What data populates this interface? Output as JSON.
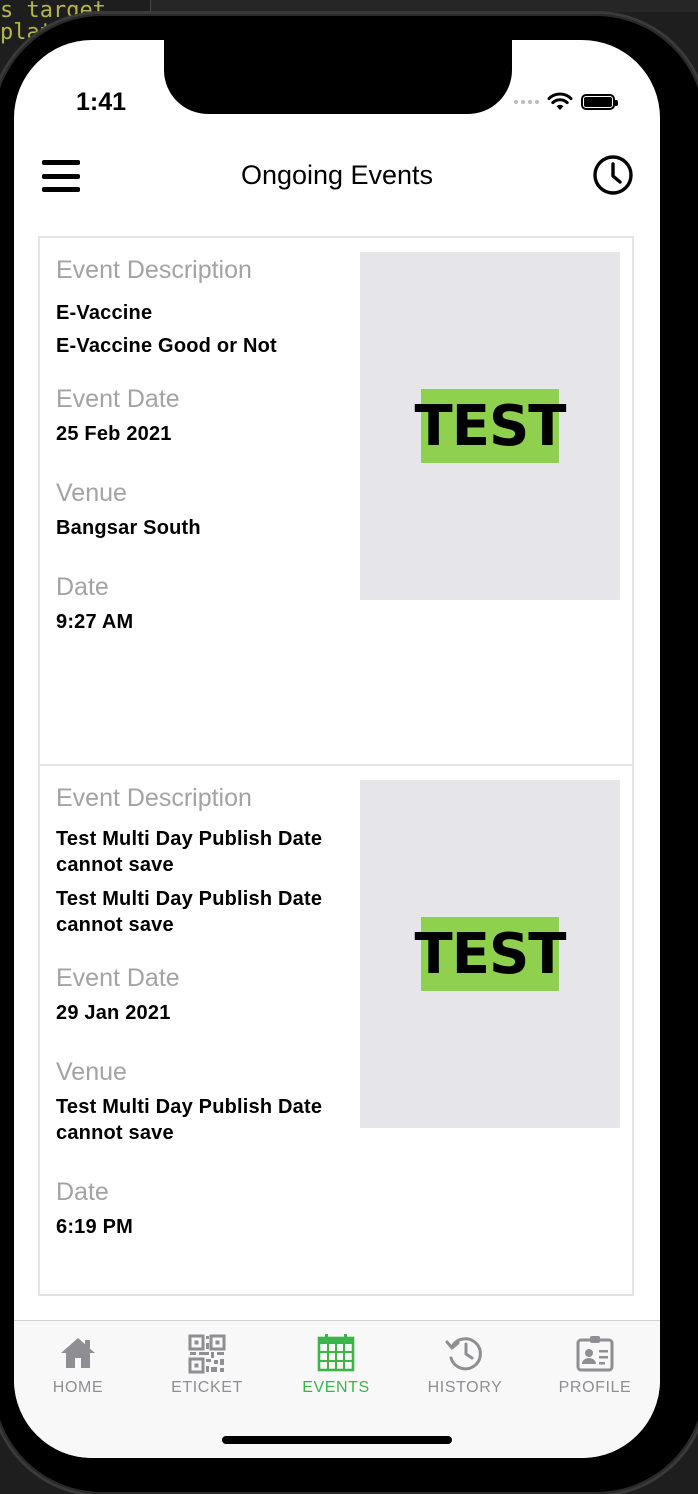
{
  "background_code": [
    "s target",
    "platf"
  ],
  "status_bar": {
    "time": "1:41"
  },
  "nav": {
    "title": "Ongoing Events"
  },
  "labels": {
    "description": "Event Description",
    "event_date": "Event Date",
    "venue": "Venue",
    "date": "Date"
  },
  "events": [
    {
      "name": "E-Vaccine",
      "description": "E-Vaccine Good or Not",
      "event_date": "25 Feb 2021",
      "venue": "Bangsar South",
      "time": "9:27 AM",
      "image_text": "TEST"
    },
    {
      "name": "Test Multi Day Publish Date cannot save",
      "description": "Test Multi Day Publish Date cannot save",
      "event_date": "29 Jan 2021",
      "venue": "Test Multi Day Publish Date cannot save",
      "time": "6:19 PM",
      "image_text": "TEST"
    }
  ],
  "tabs": [
    {
      "label": "HOME",
      "icon": "home-icon",
      "active": false
    },
    {
      "label": "ETICKET",
      "icon": "qr-code-icon",
      "active": false
    },
    {
      "label": "EVENTS",
      "icon": "calendar-icon",
      "active": true
    },
    {
      "label": "HISTORY",
      "icon": "history-icon",
      "active": false
    },
    {
      "label": "PROFILE",
      "icon": "profile-card-icon",
      "active": false
    }
  ],
  "colors": {
    "accent": "#3bb54a",
    "label_grey": "#a3a3a3",
    "image_placeholder": "#e5e5ea",
    "test_badge": "#8fd14f"
  }
}
